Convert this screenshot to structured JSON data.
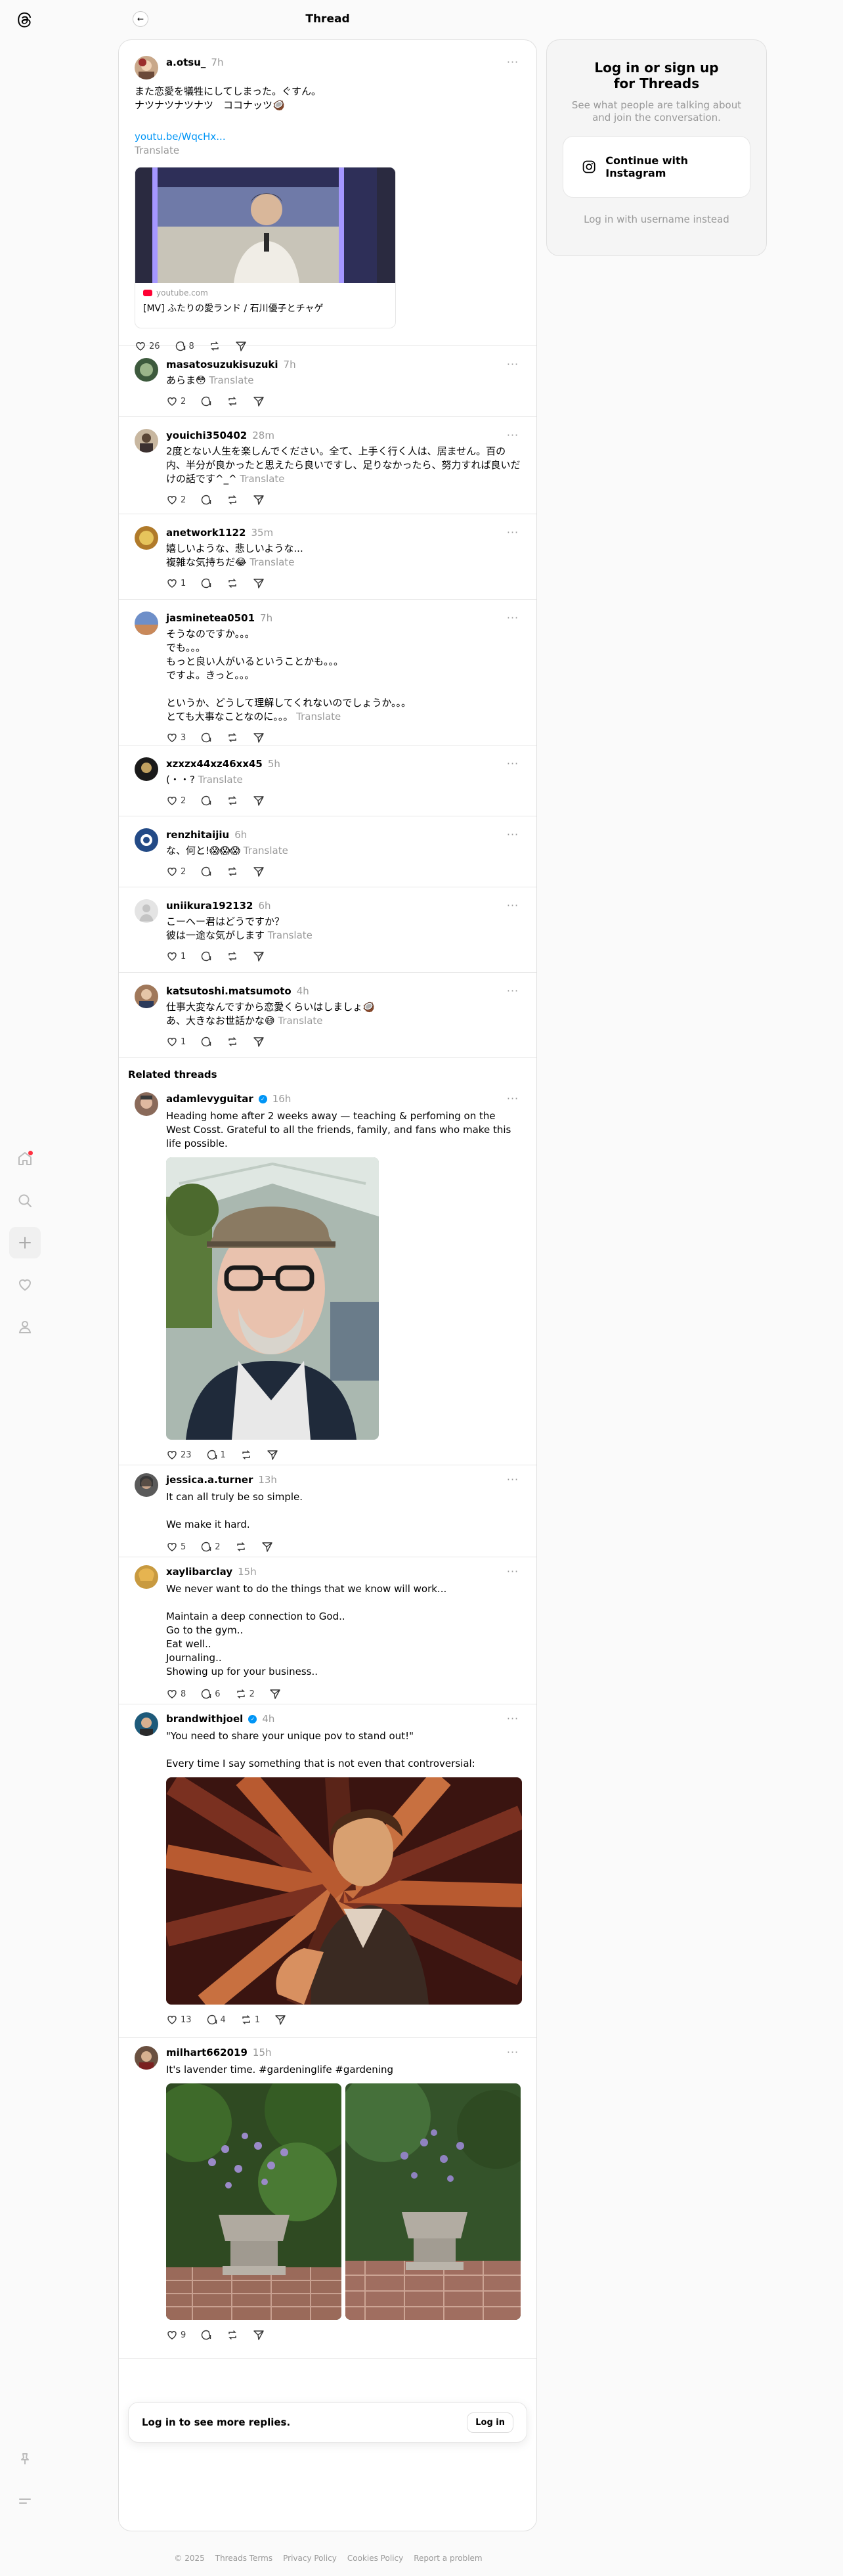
{
  "header": {
    "title": "Thread"
  },
  "main_post": {
    "author": "a.otsu_",
    "time": "7h",
    "text": "また恋愛を犠牲にしてしまった。ぐすん。\nナツナツナツナツ　ココナッツ🥥",
    "link": "youtu.be/WqcHx...",
    "translate": "Translate",
    "card": {
      "domain": "youtube.com",
      "title": "[MV] ふたりの愛ランド / 石川優子とチャゲ"
    },
    "likes": "26",
    "replies": "8"
  },
  "replies": [
    {
      "author": "masatosuzukisuzuki",
      "time": "7h",
      "text": "あらま😳",
      "likes": "2"
    },
    {
      "author": "youichi350402",
      "time": "28m",
      "text": "2度とない人生を楽しんでください。全て、上手く行く人は、居ません。百の内、半分が良かったと思えたら良いですし、足りなかったら、努力すれば良いだけの話です^_^",
      "likes": "2"
    },
    {
      "author": "anetwork1122",
      "time": "35m",
      "text": "嬉しいような、悲しいような...\n複雑な気持ちだ😂",
      "likes": "1"
    },
    {
      "author": "jasminetea0501",
      "time": "7h",
      "text": "そうなのですか。。。\nでも。。。\nもっと良い人がいるということかも。。。\nですよ。きっと。。。\n\nというか、どうして理解してくれないのでしょうか。。。\nとても大事なことなのに。。。",
      "likes": "3"
    },
    {
      "author": "xzxzx44xz46xx45",
      "time": "5h",
      "text": "(・・?",
      "likes": "2"
    },
    {
      "author": "renzhitaijiu",
      "time": "6h",
      "text": "な、何と!😱😱😱",
      "likes": "2"
    },
    {
      "author": "uniikura192132",
      "time": "6h",
      "text": "こーへー君はどうですか？\n彼は一途な気がします",
      "likes": "1"
    },
    {
      "author": "katsutoshi.matsumoto",
      "time": "4h",
      "text": "仕事大変なんですから恋愛くらいはしましょ🥥\nあ、大きなお世話かな😅",
      "likes": "1"
    }
  ],
  "related": {
    "title": "Related threads",
    "posts": [
      {
        "author": "adamlevyguitar",
        "verified": true,
        "time": "16h",
        "text": "Heading home after 2 weeks away — teaching & perfoming on the West Cosst. Grateful to all the friends, family, and fans who make this life possible.",
        "likes": "23",
        "replies": "1",
        "reposts": ""
      },
      {
        "author": "jessica.a.turner",
        "verified": false,
        "time": "13h",
        "text": "It can all truly be so simple.\n\nWe make it hard.",
        "likes": "5",
        "replies": "2",
        "reposts": ""
      },
      {
        "author": "xaylibarclay",
        "verified": false,
        "time": "15h",
        "text": "We never want to do the things that we know will work...\n\nMaintain a deep connection to God..\nGo to the gym..\nEat well..\nJournaling..\nShowing up for your business..",
        "likes": "8",
        "replies": "6",
        "reposts": "2"
      },
      {
        "author": "brandwithjoel",
        "verified": true,
        "time": "4h",
        "text": "\"You need to share your unique pov to stand out!\"\n\nEvery time I say something that is not even that controversial:",
        "likes": "13",
        "replies": "4",
        "reposts": "1"
      },
      {
        "author": "milhart662019",
        "verified": false,
        "time": "15h",
        "text": "It's lavender time. #gardeninglife #gardening",
        "likes": "9",
        "replies": "",
        "reposts": ""
      }
    ]
  },
  "translate_label": "Translate",
  "login_prompt": {
    "text": "Log in to see more replies.",
    "button": "Log in"
  },
  "side": {
    "title": "Log in or sign up for Threads",
    "subtitle": "See what people are talking about and join the conversation.",
    "instagram_button": "Continue with Instagram",
    "alt_login": "Log in with username instead"
  },
  "footer": [
    "© 2025",
    "Threads Terms",
    "Privacy Policy",
    "Cookies Policy",
    "Report a problem"
  ],
  "colors": {
    "accent": "#0095f6",
    "muted": "#999999",
    "notification": "#ff3040"
  }
}
